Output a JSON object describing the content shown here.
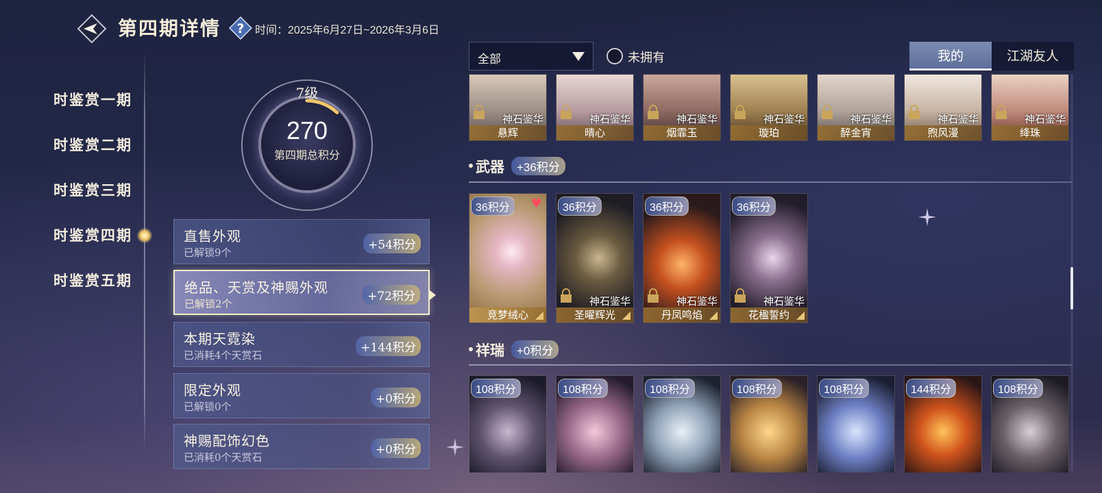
{
  "header": {
    "title": "第四期详情",
    "time_label": "时间：2025年6月27日~2026年3月6日"
  },
  "nav": {
    "items": [
      "时鉴赏一期",
      "时鉴赏二期",
      "时鉴赏三期",
      "时鉴赏四期",
      "时鉴赏五期"
    ],
    "active_index": 3
  },
  "score": {
    "level": "7级",
    "value": "270",
    "label": "第四期总积分",
    "progress": 0.12
  },
  "categories": [
    {
      "name": "直售外观",
      "sub": "已解锁9个",
      "points": "+54积分"
    },
    {
      "name": "绝品、天赏及神赐外观",
      "sub": "已解锁2个",
      "points": "+72积分"
    },
    {
      "name": "本期天霓染",
      "sub": "已消耗4个天赏石",
      "points": "+144积分"
    },
    {
      "name": "限定外观",
      "sub": "已解锁0个",
      "points": "+0积分"
    },
    {
      "name": "神赐配饰幻色",
      "sub": "已消耗0个天赏石",
      "points": "+0积分"
    }
  ],
  "active_category": 1,
  "filter": {
    "select_value": "全部",
    "unowned_label": "未拥有"
  },
  "tabs": {
    "mine": "我的",
    "friends": "江湖友人"
  },
  "top_row": {
    "rarity": "神石鉴华",
    "names": [
      "悬辉",
      "晴心",
      "烟霏玉",
      "璇珀",
      "醉金宵",
      "煦风漫",
      "绛珠"
    ]
  },
  "weapons": {
    "title": "武器",
    "points": "+36积分",
    "items": [
      {
        "badge": "36积分",
        "name": "竞梦绒心",
        "rarity": "",
        "favorite": true
      },
      {
        "badge": "36积分",
        "name": "圣曜辉光",
        "rarity": "神石鉴华",
        "favorite": false
      },
      {
        "badge": "36积分",
        "name": "丹凤鸣焰",
        "rarity": "神石鉴华",
        "favorite": false
      },
      {
        "badge": "36积分",
        "name": "花楹誓约",
        "rarity": "神石鉴华",
        "favorite": false
      }
    ]
  },
  "auspicious": {
    "title": "祥瑞",
    "points": "+0积分",
    "badges": [
      "108积分",
      "108积分",
      "108积分",
      "108积分",
      "108积分",
      "144积分",
      "108积分"
    ]
  },
  "colors": {
    "accent_gold": "#f0c76a",
    "heart": "#ff4d5e",
    "tab_active": "#6e80aa"
  }
}
